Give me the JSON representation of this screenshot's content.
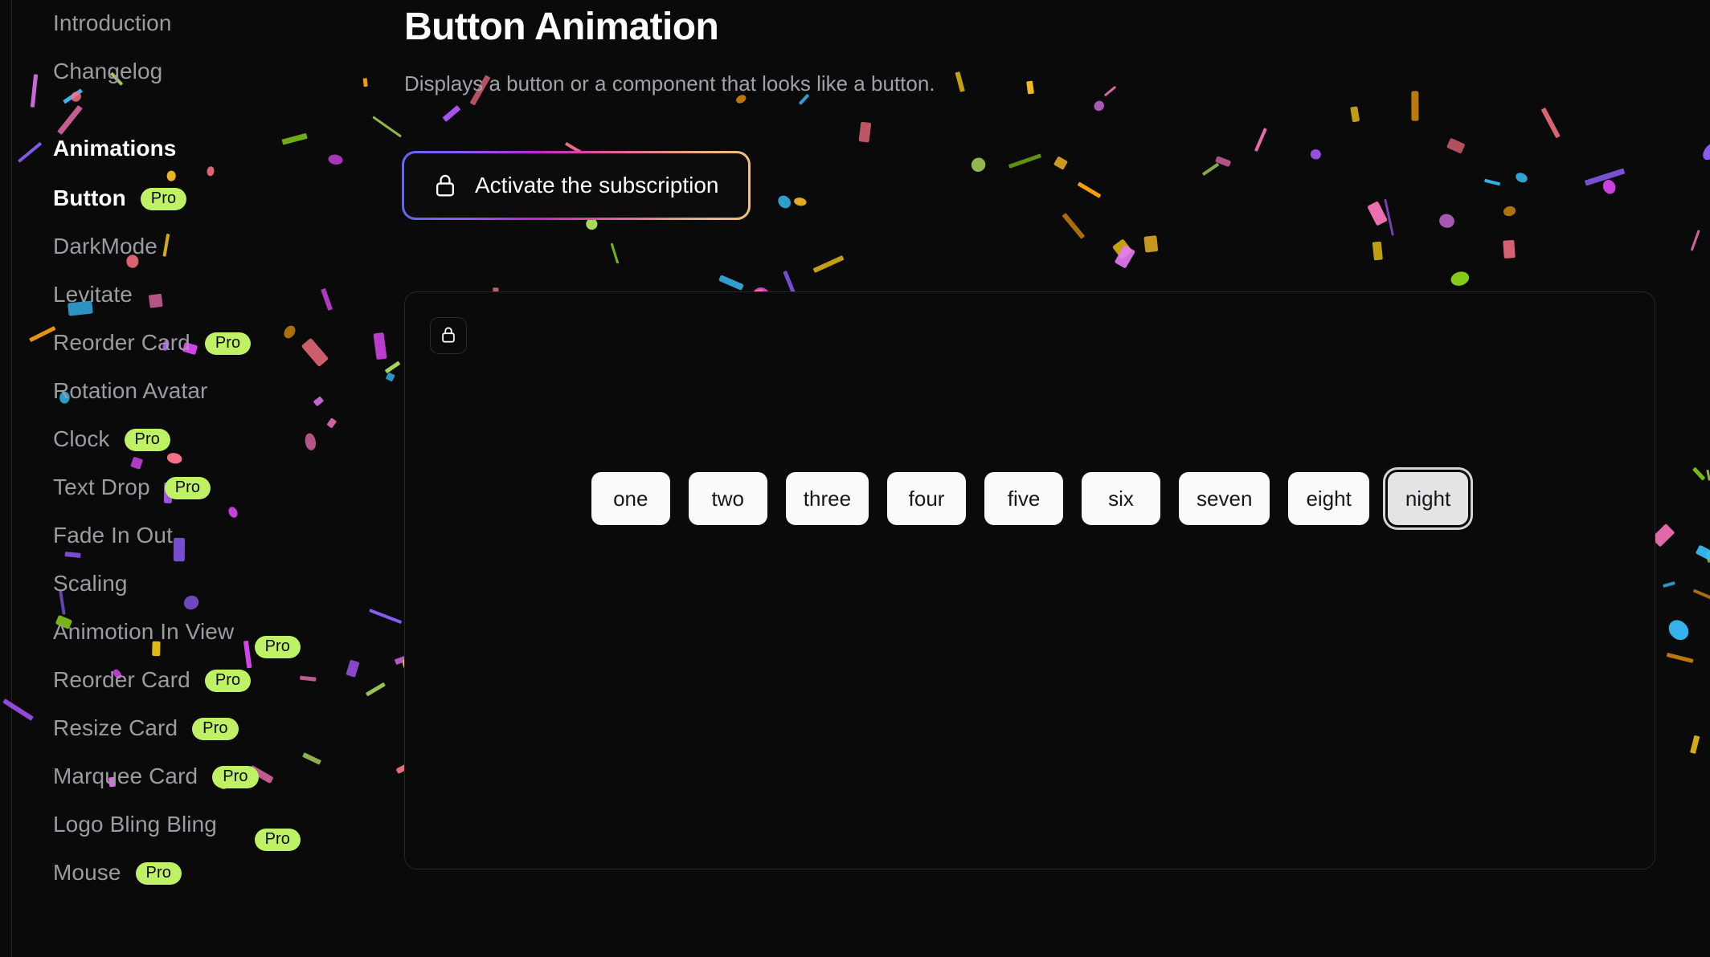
{
  "sidebar": {
    "items": [
      {
        "label": "Introduction",
        "pro": false,
        "type": "link",
        "state": "normal"
      },
      {
        "label": "Changelog",
        "pro": false,
        "type": "link",
        "state": "normal"
      },
      {
        "label": "Animations",
        "pro": false,
        "type": "section",
        "state": "section"
      },
      {
        "label": "Button",
        "pro": true,
        "pro_label": "Pro",
        "type": "link",
        "state": "active"
      },
      {
        "label": "DarkMode",
        "pro": false,
        "type": "link",
        "state": "normal"
      },
      {
        "label": "Levitate",
        "pro": false,
        "type": "link",
        "state": "normal"
      },
      {
        "label": "Reorder Card",
        "pro": true,
        "pro_label": "Pro",
        "type": "link",
        "state": "normal"
      },
      {
        "label": "Rotation Avatar",
        "pro": false,
        "type": "link",
        "state": "normal"
      },
      {
        "label": "Clock",
        "pro": true,
        "pro_label": "Pro",
        "type": "link",
        "state": "normal"
      },
      {
        "label": "Text Drop",
        "pro": true,
        "pro_label": "Pro",
        "type": "link",
        "state": "normal"
      },
      {
        "label": "Fade In Out",
        "pro": false,
        "type": "link",
        "state": "normal"
      },
      {
        "label": "Scaling",
        "pro": false,
        "type": "link",
        "state": "normal"
      },
      {
        "label": "Animotion In View",
        "pro": true,
        "pro_label": "Pro",
        "type": "link",
        "state": "normal",
        "wrap": true
      },
      {
        "label": "Reorder Card",
        "pro": true,
        "pro_label": "Pro",
        "type": "link",
        "state": "normal"
      },
      {
        "label": "Resize Card",
        "pro": true,
        "pro_label": "Pro",
        "type": "link",
        "state": "normal"
      },
      {
        "label": "Marquee Card",
        "pro": true,
        "pro_label": "Pro",
        "type": "link",
        "state": "normal"
      },
      {
        "label": "Logo Bling Bling",
        "pro": true,
        "pro_label": "Pro",
        "type": "link",
        "state": "normal",
        "wrap": true
      },
      {
        "label": "Mouse",
        "pro": true,
        "pro_label": "Pro",
        "type": "link",
        "state": "normal"
      }
    ]
  },
  "header": {
    "title": "Button Animation",
    "subtitle": "Displays a button or a component that looks like a button."
  },
  "cta": {
    "label": "Activate the subscription",
    "icon": "lock-icon",
    "gradient_from": "#6366f1",
    "gradient_mid": "#d946a8",
    "gradient_to": "#f2c17e"
  },
  "preview": {
    "lock_chip_icon": "lock-icon",
    "chips": [
      {
        "label": "one",
        "focused": false
      },
      {
        "label": "two",
        "focused": false
      },
      {
        "label": "three",
        "focused": false
      },
      {
        "label": "four",
        "focused": false
      },
      {
        "label": "five",
        "focused": false
      },
      {
        "label": "six",
        "focused": false
      },
      {
        "label": "seven",
        "focused": false
      },
      {
        "label": "eight",
        "focused": false
      },
      {
        "label": "night",
        "focused": true
      }
    ]
  },
  "theme": {
    "background": "#0a0a0a",
    "pro_badge_bg": "#bef264",
    "pro_badge_text": "#0a0a0a",
    "muted_text": "#9b9ba1",
    "chip_bg": "#fafafa",
    "card_border": "#262626",
    "confetti_colors": [
      "#38bdf8",
      "#f59e0b",
      "#bef264",
      "#f472b6",
      "#a855f7",
      "#e879f9",
      "#fb7185",
      "#facc15",
      "#84cc16",
      "#8b5cf6",
      "#d946ef",
      "#fbbf24"
    ]
  }
}
